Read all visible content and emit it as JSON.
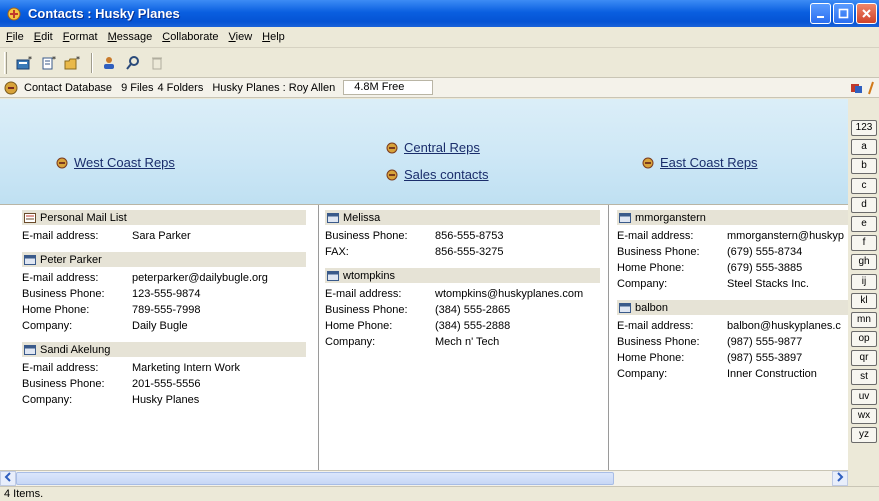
{
  "window": {
    "title": "Contacts : Husky Planes"
  },
  "menu": [
    "File",
    "Edit",
    "Format",
    "Message",
    "Collaborate",
    "View",
    "Help"
  ],
  "infobar": {
    "db_label": "Contact Database",
    "files": "9 Files",
    "folders": "4 Folders",
    "location": "Husky Planes : Roy Allen",
    "free": "4.8M Free"
  },
  "groups": {
    "west": "West Coast Reps",
    "central": "Central Reps",
    "sales": "Sales contacts",
    "east": "East Coast Reps"
  },
  "alpha_tabs": [
    "123",
    "a",
    "b",
    "c",
    "d",
    "e",
    "f",
    "gh",
    "ij",
    "kl",
    "mn",
    "op",
    "qr",
    "st",
    "uv",
    "wx",
    "yz"
  ],
  "columns": [
    {
      "cards": [
        {
          "name": "Personal Mail List",
          "icon": "list-icon",
          "rows": [
            {
              "label": "E-mail address:",
              "value": "Sara Parker"
            }
          ]
        },
        {
          "name": "Peter Parker",
          "icon": "contact-card-icon",
          "rows": [
            {
              "label": "E-mail address:",
              "value": "peterparker@dailybugle.org"
            },
            {
              "label": "Business Phone:",
              "value": "123-555-9874"
            },
            {
              "label": "Home Phone:",
              "value": "789-555-7998"
            },
            {
              "label": "Company:",
              "value": "Daily Bugle"
            }
          ]
        },
        {
          "name": "Sandi Akelung",
          "icon": "contact-card-icon",
          "rows": [
            {
              "label": "E-mail address:",
              "value": "Marketing Intern Work"
            },
            {
              "label": "Business Phone:",
              "value": "201-555-5556"
            },
            {
              "label": "Company:",
              "value": "Husky Planes"
            }
          ]
        }
      ]
    },
    {
      "cards": [
        {
          "name": "Melissa",
          "icon": "contact-card-icon",
          "rows": [
            {
              "label": "Business Phone:",
              "value": "856-555-8753"
            },
            {
              "label": "FAX:",
              "value": "856-555-3275"
            }
          ]
        },
        {
          "name": "wtompkins",
          "icon": "contact-card-icon",
          "rows": [
            {
              "label": "E-mail address:",
              "value": "wtompkins@huskyplanes.com"
            },
            {
              "label": "Business Phone:",
              "value": "(384) 555-2865"
            },
            {
              "label": "Home Phone:",
              "value": "(384) 555-2888"
            },
            {
              "label": "Company:",
              "value": "Mech n' Tech"
            }
          ]
        }
      ]
    },
    {
      "cards": [
        {
          "name": "mmorganstern",
          "icon": "contact-card-icon",
          "rows": [
            {
              "label": "E-mail address:",
              "value": "mmorganstern@huskyp"
            },
            {
              "label": "Business Phone:",
              "value": "(679) 555-8734"
            },
            {
              "label": "Home Phone:",
              "value": "(679) 555-3885"
            },
            {
              "label": "Company:",
              "value": "Steel Stacks Inc."
            }
          ]
        },
        {
          "name": "balbon",
          "icon": "contact-card-icon",
          "rows": [
            {
              "label": "E-mail address:",
              "value": "balbon@huskyplanes.c"
            },
            {
              "label": "Business Phone:",
              "value": "(987) 555-9877"
            },
            {
              "label": "Home Phone:",
              "value": "(987) 555-3897"
            },
            {
              "label": "Company:",
              "value": "Inner Construction"
            }
          ]
        }
      ]
    }
  ],
  "status": "4 Items."
}
